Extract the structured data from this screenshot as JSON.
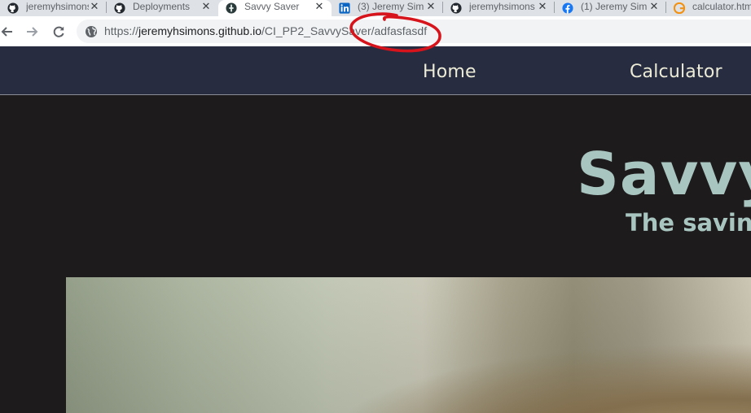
{
  "tabs": [
    {
      "title": "jeremyhsimons",
      "icon": "github-icon",
      "active": false
    },
    {
      "title": "Deployments",
      "icon": "github-icon",
      "active": false
    },
    {
      "title": "Savvy Saver",
      "icon": "site-favicon-icon",
      "active": true
    },
    {
      "title": "(3) Jeremy Sim",
      "icon": "linkedin-icon",
      "active": false
    },
    {
      "title": "jeremyhsimons",
      "icon": "github-icon",
      "active": false
    },
    {
      "title": "(1) Jeremy Sim",
      "icon": "facebook-icon",
      "active": false
    },
    {
      "title": "calculator.htm",
      "icon": "code-file-icon",
      "active": false
    }
  ],
  "tab_close_glyph": "✕",
  "toolbar": {
    "url_scheme": "https://",
    "url_host": "jeremyhsimons.github.io",
    "url_path": "/CI_PP2_SavvySaver/adfasfasdf"
  },
  "site_nav": {
    "home_label": "Home",
    "calculator_label": "Calculator"
  },
  "hero": {
    "title": "Savvy",
    "subtitle": "The saving"
  },
  "colors": {
    "annotation_circle": "#d7141b",
    "nav_bg": "#272c41",
    "page_bg": "#1e1b1d",
    "hero_text": "#a9c5bf"
  }
}
